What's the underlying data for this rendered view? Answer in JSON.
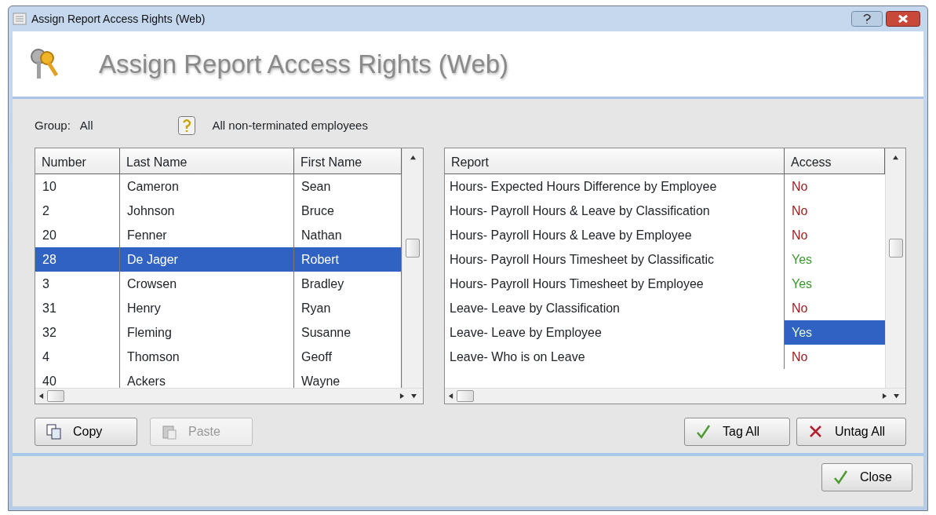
{
  "window": {
    "title": "Assign Report Access Rights (Web)"
  },
  "header": {
    "title": "Assign Report Access Rights (Web)"
  },
  "group": {
    "label": "Group:",
    "value": "All",
    "description": "All non-terminated employees"
  },
  "employees": {
    "columns": [
      "Number",
      "Last Name",
      "First Name"
    ],
    "rows": [
      {
        "cells": [
          "10",
          "Cameron",
          "Sean"
        ],
        "selected": false
      },
      {
        "cells": [
          "2",
          "Johnson",
          "Bruce"
        ],
        "selected": false
      },
      {
        "cells": [
          "20",
          "Fenner",
          "Nathan"
        ],
        "selected": false
      },
      {
        "cells": [
          "28",
          "De Jager",
          "Robert"
        ],
        "selected": true
      },
      {
        "cells": [
          "3",
          "Crowsen",
          "Bradley"
        ],
        "selected": false
      },
      {
        "cells": [
          "31",
          "Henry",
          "Ryan"
        ],
        "selected": false
      },
      {
        "cells": [
          "32",
          "Fleming",
          "Susanne"
        ],
        "selected": false
      },
      {
        "cells": [
          "4",
          "Thomson",
          "Geoff"
        ],
        "selected": false
      },
      {
        "cells": [
          "40",
          "Ackers",
          "Wayne"
        ],
        "selected": false
      }
    ]
  },
  "reports": {
    "columns": [
      "Report",
      "Access"
    ],
    "rows": [
      {
        "report": "Hours- Expected Hours Difference by Employee",
        "access": "No",
        "granted": false,
        "selected": false
      },
      {
        "report": "Hours- Payroll Hours & Leave by Classification",
        "access": "No",
        "granted": false,
        "selected": false
      },
      {
        "report": "Hours- Payroll Hours & Leave by Employee",
        "access": "No",
        "granted": false,
        "selected": false
      },
      {
        "report": "Hours- Payroll Hours Timesheet by Classificatic",
        "access": "Yes",
        "granted": true,
        "selected": false
      },
      {
        "report": "Hours- Payroll Hours Timesheet by Employee",
        "access": "Yes",
        "granted": true,
        "selected": false
      },
      {
        "report": "Leave- Leave by Classification",
        "access": "No",
        "granted": false,
        "selected": false
      },
      {
        "report": "Leave- Leave by Employee",
        "access": "Yes",
        "granted": true,
        "selected": true
      },
      {
        "report": "Leave- Who is on Leave",
        "access": "No",
        "granted": false,
        "selected": false
      }
    ]
  },
  "left_buttons": [
    {
      "label": "Copy",
      "kind": "copy",
      "disabled": false
    },
    {
      "label": "Paste",
      "kind": "paste",
      "disabled": true
    }
  ],
  "right_buttons": [
    {
      "label": "Tag All",
      "kind": "tick"
    },
    {
      "label": "Untag All",
      "kind": "cross"
    }
  ],
  "close_button": {
    "label": "Close"
  }
}
